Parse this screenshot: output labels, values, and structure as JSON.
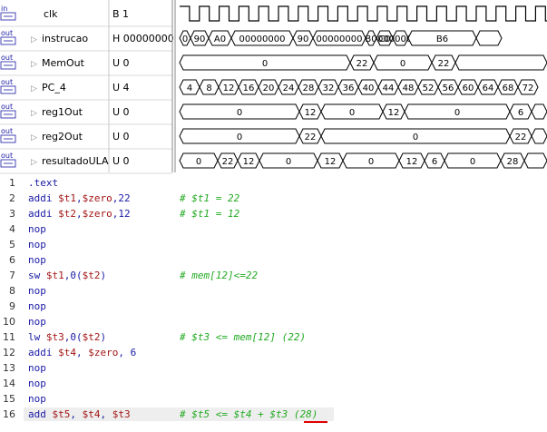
{
  "signals": [
    {
      "name": "clk",
      "value": "B 1",
      "icon": "in",
      "segments": []
    },
    {
      "name": "instrucao",
      "value": "H 00000000",
      "icon": "out",
      "segments": [
        "0",
        "90",
        "A0",
        "00000000",
        "90",
        "00000000",
        "B0",
        "C0",
        "00000000",
        "B6",
        ""
      ]
    },
    {
      "name": "MemOut",
      "value": "U 0",
      "icon": "out",
      "segments": [
        "0",
        "22",
        "0",
        "22",
        ""
      ]
    },
    {
      "name": "PC_4",
      "value": "U 4",
      "icon": "out",
      "segments": [
        "4",
        "8",
        "12",
        "16",
        "20",
        "24",
        "28",
        "32",
        "36",
        "40",
        "44",
        "48",
        "52",
        "56",
        "60",
        "64",
        "68",
        "72"
      ]
    },
    {
      "name": "reg1Out",
      "value": "U 0",
      "icon": "out",
      "segments": [
        "0",
        "12",
        "0",
        "12",
        "0",
        "6",
        ""
      ]
    },
    {
      "name": "reg2Out",
      "value": "U 0",
      "icon": "out",
      "segments": [
        "0",
        "22",
        "0",
        "22",
        ""
      ]
    },
    {
      "name": "resultadoULA",
      "value": "U 0",
      "icon": "out",
      "segments": [
        "0",
        "22",
        "12",
        "0",
        "12",
        "0",
        "12",
        "6",
        "0",
        "28",
        ""
      ]
    }
  ],
  "code": [
    {
      "n": "1",
      "text": ".text",
      "comment": ""
    },
    {
      "n": "2",
      "text": "addi $t1,$zero,22",
      "comment": "# $t1 = 22"
    },
    {
      "n": "3",
      "text": "addi $t2,$zero,12",
      "comment": "# $t1 = 12"
    },
    {
      "n": "4",
      "text": "nop",
      "comment": ""
    },
    {
      "n": "5",
      "text": "nop",
      "comment": ""
    },
    {
      "n": "6",
      "text": "nop",
      "comment": ""
    },
    {
      "n": "7",
      "text": "sw $t1,0($t2)",
      "comment": "# mem[12]<=22"
    },
    {
      "n": "8",
      "text": "nop",
      "comment": ""
    },
    {
      "n": "9",
      "text": "nop",
      "comment": ""
    },
    {
      "n": "10",
      "text": "nop",
      "comment": ""
    },
    {
      "n": "11",
      "text": "lw $t3,0($t2)",
      "comment": "# $t3 <= mem[12] (22)"
    },
    {
      "n": "12",
      "text": "addi $t4, $zero, 6",
      "comment": ""
    },
    {
      "n": "13",
      "text": "nop",
      "comment": ""
    },
    {
      "n": "14",
      "text": "nop",
      "comment": ""
    },
    {
      "n": "15",
      "text": "nop",
      "comment": ""
    },
    {
      "n": "16",
      "text": "add $t5, $t4, $t3",
      "comment": "# $t5 <= $t4 + $t3 (28)"
    }
  ],
  "colors": {
    "wave": "#000000",
    "grid": "#c8c8c8",
    "underline": "#e00000",
    "code": "#1a1aa6",
    "comment": "#22aa22"
  }
}
